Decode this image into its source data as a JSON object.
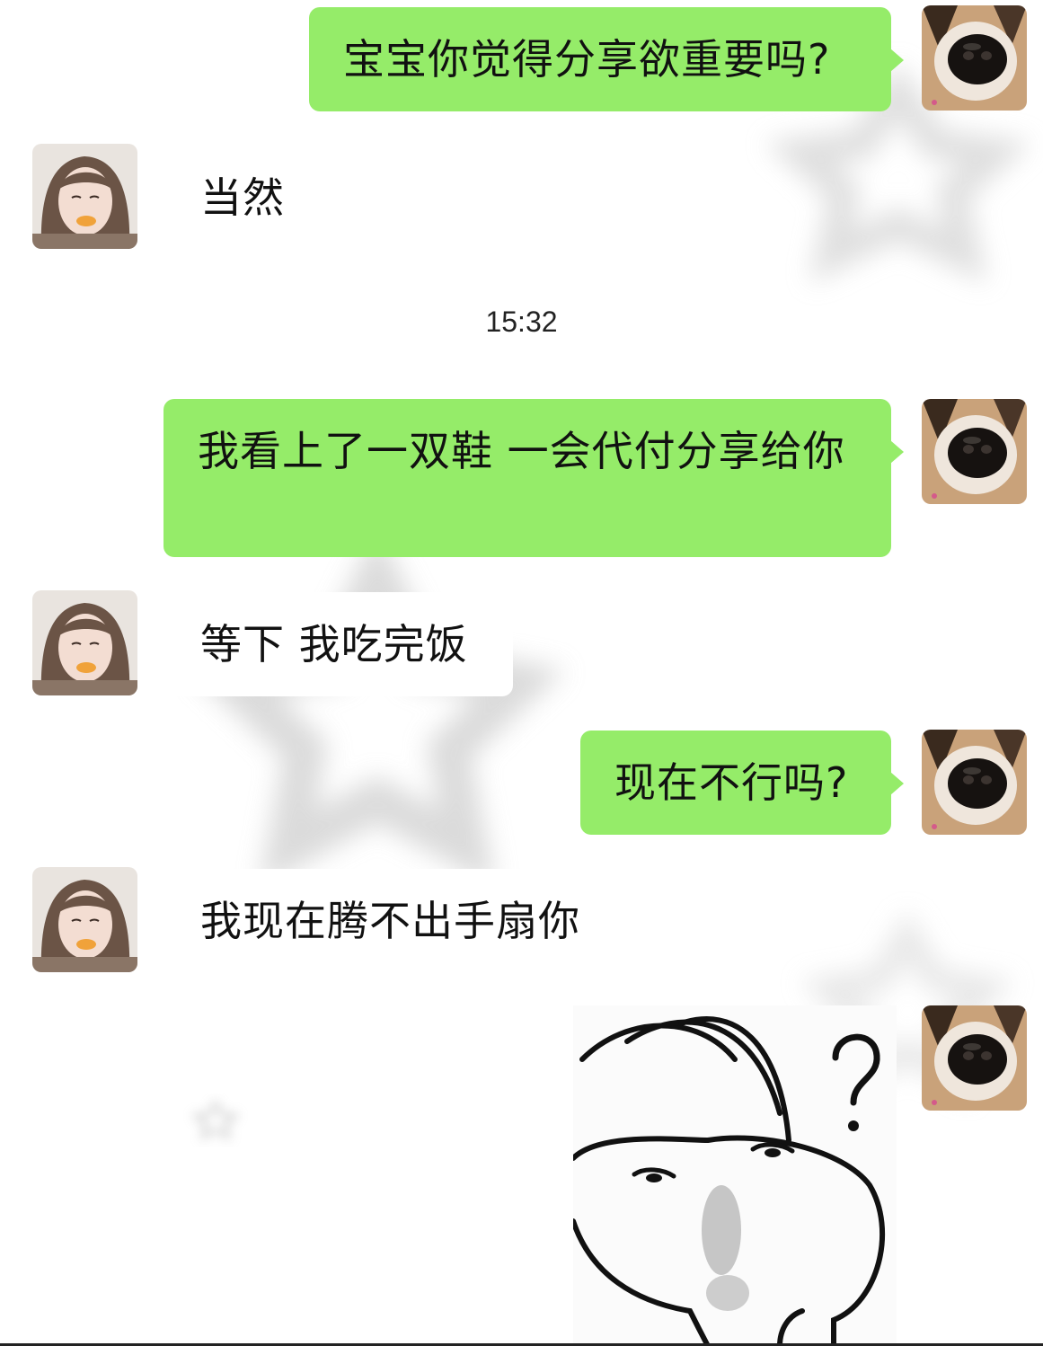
{
  "chat": {
    "messages": [
      {
        "side": "sent",
        "text": "宝宝你觉得分享欲重要吗?"
      },
      {
        "side": "received",
        "text": "当然"
      },
      {
        "side": "timestamp",
        "text": "15:32"
      },
      {
        "side": "sent",
        "text": "我看上了一双鞋 一会代付分享给你"
      },
      {
        "side": "received",
        "text": "等下 我吃完饭"
      },
      {
        "side": "sent",
        "text": "现在不行吗?"
      },
      {
        "side": "received",
        "text": "我现在腾不出手扇你"
      },
      {
        "side": "sent",
        "type": "sticker",
        "sticker": "confused-rabbit-sticker"
      }
    ]
  },
  "avatars": {
    "me": "dog-nose-avatar",
    "friend": "girl-avatar"
  },
  "colors": {
    "sent_bubble": "#95ec69",
    "received_bubble": "#ffffff",
    "background": "#ffffff"
  }
}
